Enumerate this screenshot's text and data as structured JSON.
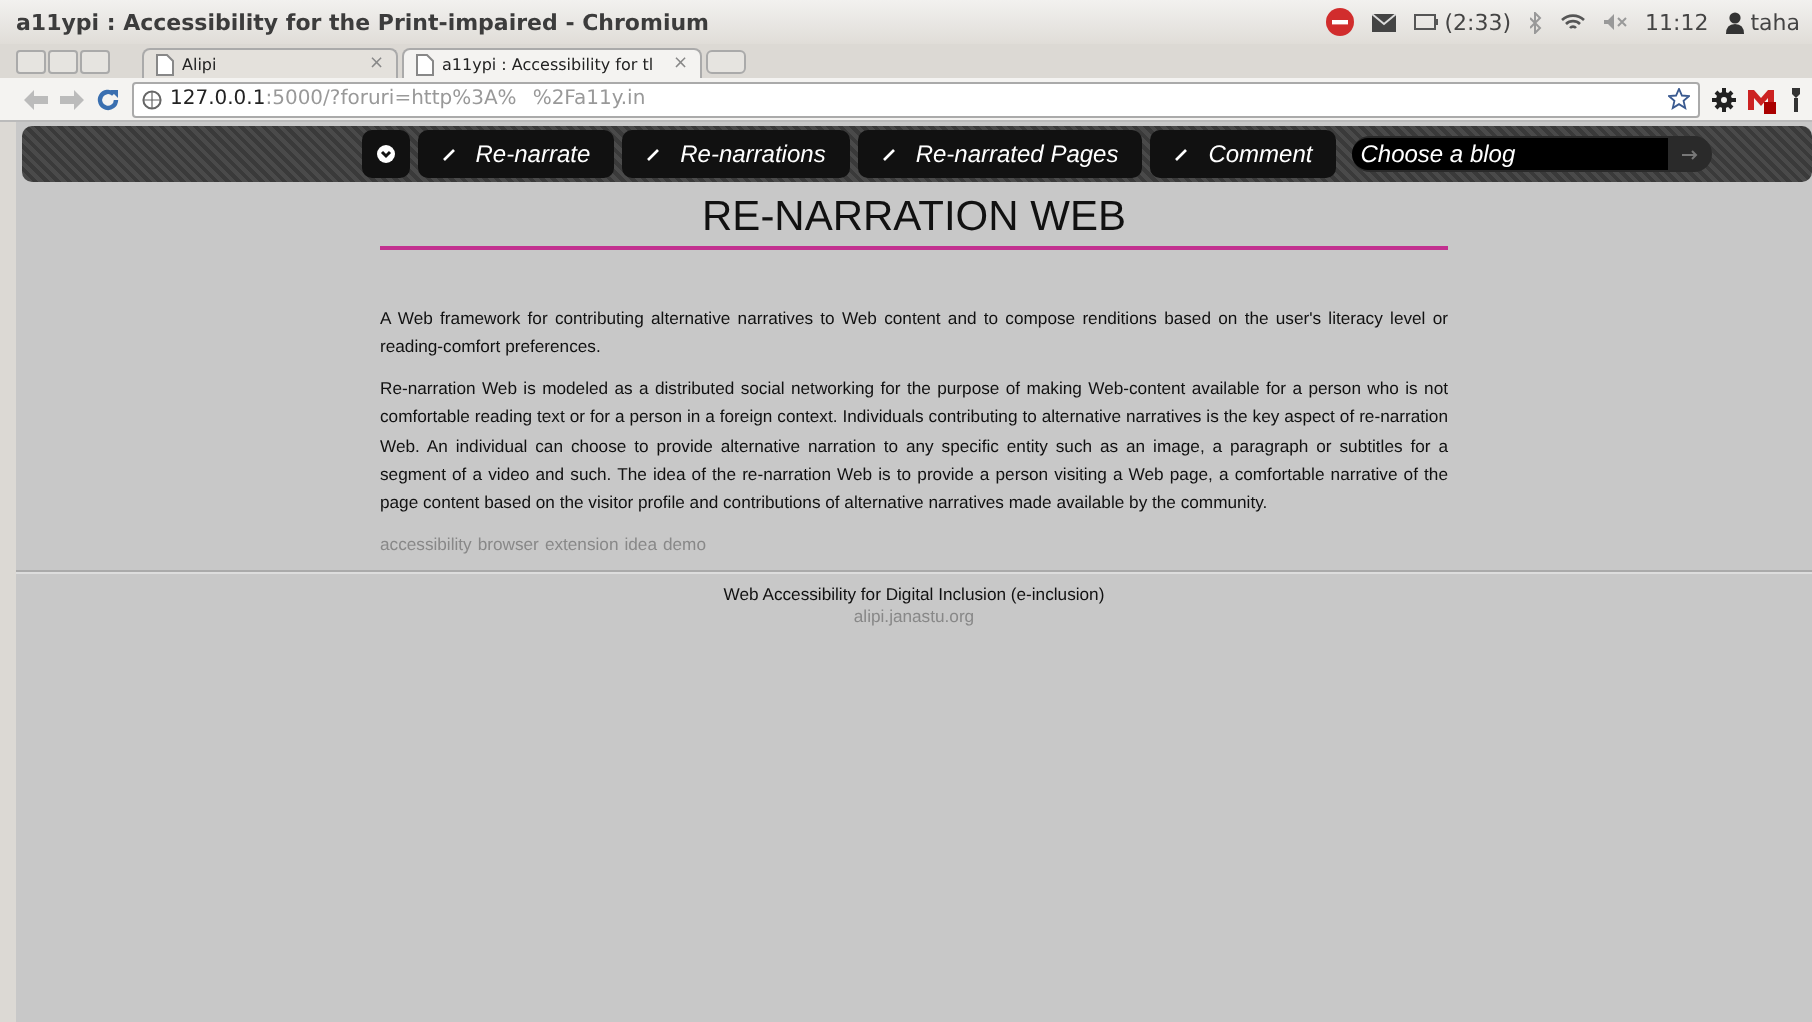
{
  "window": {
    "title": "a11ypi : Accessibility for the Print-impaired - Chromium"
  },
  "tray": {
    "battery": "(2:33)",
    "clock": "11:12",
    "user": "taha"
  },
  "tabs": [
    {
      "label": "Alipi",
      "close": "×",
      "selected": false
    },
    {
      "label": "a11ypi : Accessibility for tl",
      "close": "×",
      "selected": true
    }
  ],
  "address_bar": {
    "host": "127.0.0.1",
    "rest": ":5000/?foruri=http%3A%",
    "tail": "%2Fa11y.in"
  },
  "nav": {
    "items": [
      {
        "kind": "icon"
      },
      {
        "kind": "link",
        "label": "Re-narrate"
      },
      {
        "kind": "link",
        "label": "Re-narrations"
      },
      {
        "kind": "link",
        "label": "Re-narrated Pages"
      },
      {
        "kind": "link",
        "label": "Comment"
      }
    ],
    "blog_field": {
      "placeholder": "Choose a blog"
    }
  },
  "page": {
    "heading": "RE-NARRATION WEB",
    "paragraphs": [
      "A Web framework for contributing alternative narratives to Web content and to compose renditions based on the user's literacy level or reading-comfort preferences.",
      "Re-narration Web is modeled as a distributed social networking for the purpose of making Web-content available for a person who is not comfortable reading text or for a person in a foreign context. Individuals contributing to alternative narratives is the key aspect of re-narration Web. An individual can choose to provide alternative narration to any specific entity such as an image, a paragraph or subtitles for a segment of a video and such. The idea of the re-narration Web is to provide a person visiting a Web page, a comfortable narrative of the page content based on the visitor profile and contributions of alternative narratives made available by the community."
    ],
    "tags": [
      "accessibility",
      "browser",
      "extension",
      "idea",
      "demo"
    ]
  },
  "footer": {
    "title": "Web Accessibility for Digital Inclusion (e-inclusion)",
    "link": "alipi.janastu.org"
  }
}
